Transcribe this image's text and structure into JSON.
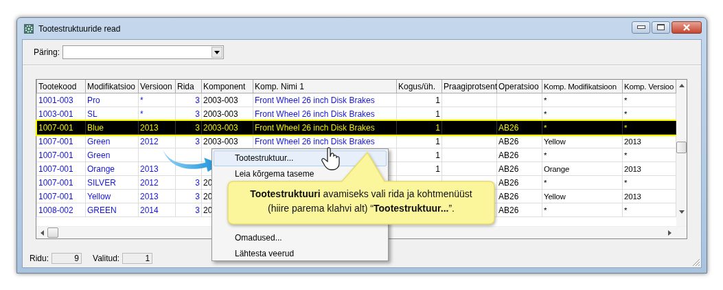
{
  "window": {
    "title": "Tootestruktuuride read"
  },
  "query": {
    "label": "Päring:"
  },
  "table": {
    "columns": [
      "Tootekood",
      "Modifikatsioo",
      "Versioon",
      "Rida",
      "Komponent",
      "Komp. Nimi 1",
      "Kogus/üh.",
      "Praagiprotsent",
      "Operatsioo",
      "Komp. Modifikatsioon",
      "Komp. Versioo"
    ],
    "rows": [
      {
        "selected": false,
        "cells": [
          "1001-003",
          "Pro",
          "*",
          "3",
          "2003-003",
          "Front Wheel 26 inch Disk Brakes",
          "1",
          null,
          null,
          "*",
          "*"
        ]
      },
      {
        "selected": false,
        "cells": [
          "1003-001",
          "SL",
          "*",
          "3",
          "2003-003",
          "Front Wheel 26 inch Disk Brakes",
          "1",
          null,
          null,
          "*",
          "*"
        ]
      },
      {
        "selected": true,
        "cells": [
          "1007-001",
          "Blue",
          "2013",
          "3",
          "2003-003",
          "Front Wheel 26 inch Disk Brakes",
          "1",
          null,
          "AB26",
          "*",
          "*"
        ]
      },
      {
        "selected": false,
        "cells": [
          "1007-001",
          "Green",
          "2012",
          "3",
          "2003-003",
          "Front Wheel 26 inch Disk Brakes",
          "1",
          null,
          "AB26",
          "Yellow",
          "2013"
        ]
      },
      {
        "selected": false,
        "cells": [
          "1007-001",
          "Green",
          null,
          null,
          null,
          null,
          "1",
          null,
          "AB26",
          "*",
          "*"
        ]
      },
      {
        "selected": false,
        "cells": [
          "1007-001",
          "Orange",
          "2013",
          null,
          null,
          null,
          "1",
          null,
          "AB26",
          "Orange",
          "2013"
        ]
      },
      {
        "selected": false,
        "cells": [
          "1007-001",
          "SILVER",
          "2012",
          "3",
          "20",
          null,
          null,
          null,
          "AB26",
          "*",
          "*"
        ]
      },
      {
        "selected": false,
        "cells": [
          "1007-001",
          "Yellow",
          "2013",
          "3",
          "20",
          null,
          null,
          null,
          "AB26",
          "Yellow",
          "2013"
        ]
      },
      {
        "selected": false,
        "cells": [
          "1008-002",
          "GREEN",
          "2014",
          "3",
          "20",
          null,
          null,
          null,
          "AB26",
          "*",
          "*"
        ]
      }
    ]
  },
  "context_menu": {
    "items": [
      {
        "label": "Tootestruktuur...",
        "selected": true
      },
      {
        "label": "Leia kõrgema taseme",
        "selected": false
      },
      {
        "label": "Omadused...",
        "selected": false
      },
      {
        "label": "Lähtesta veerud",
        "selected": false
      }
    ]
  },
  "callout": {
    "text": "**Tootestruktuuri** avamiseks vali rida ja kohtmenüüst (hiire parema klahvi alt) “**Tootestruktuur...**”."
  },
  "status_bar": {
    "rows_label": "Ridu:",
    "rows_value": "9",
    "selected_label": "Valitud:",
    "selected_value": "1"
  }
}
